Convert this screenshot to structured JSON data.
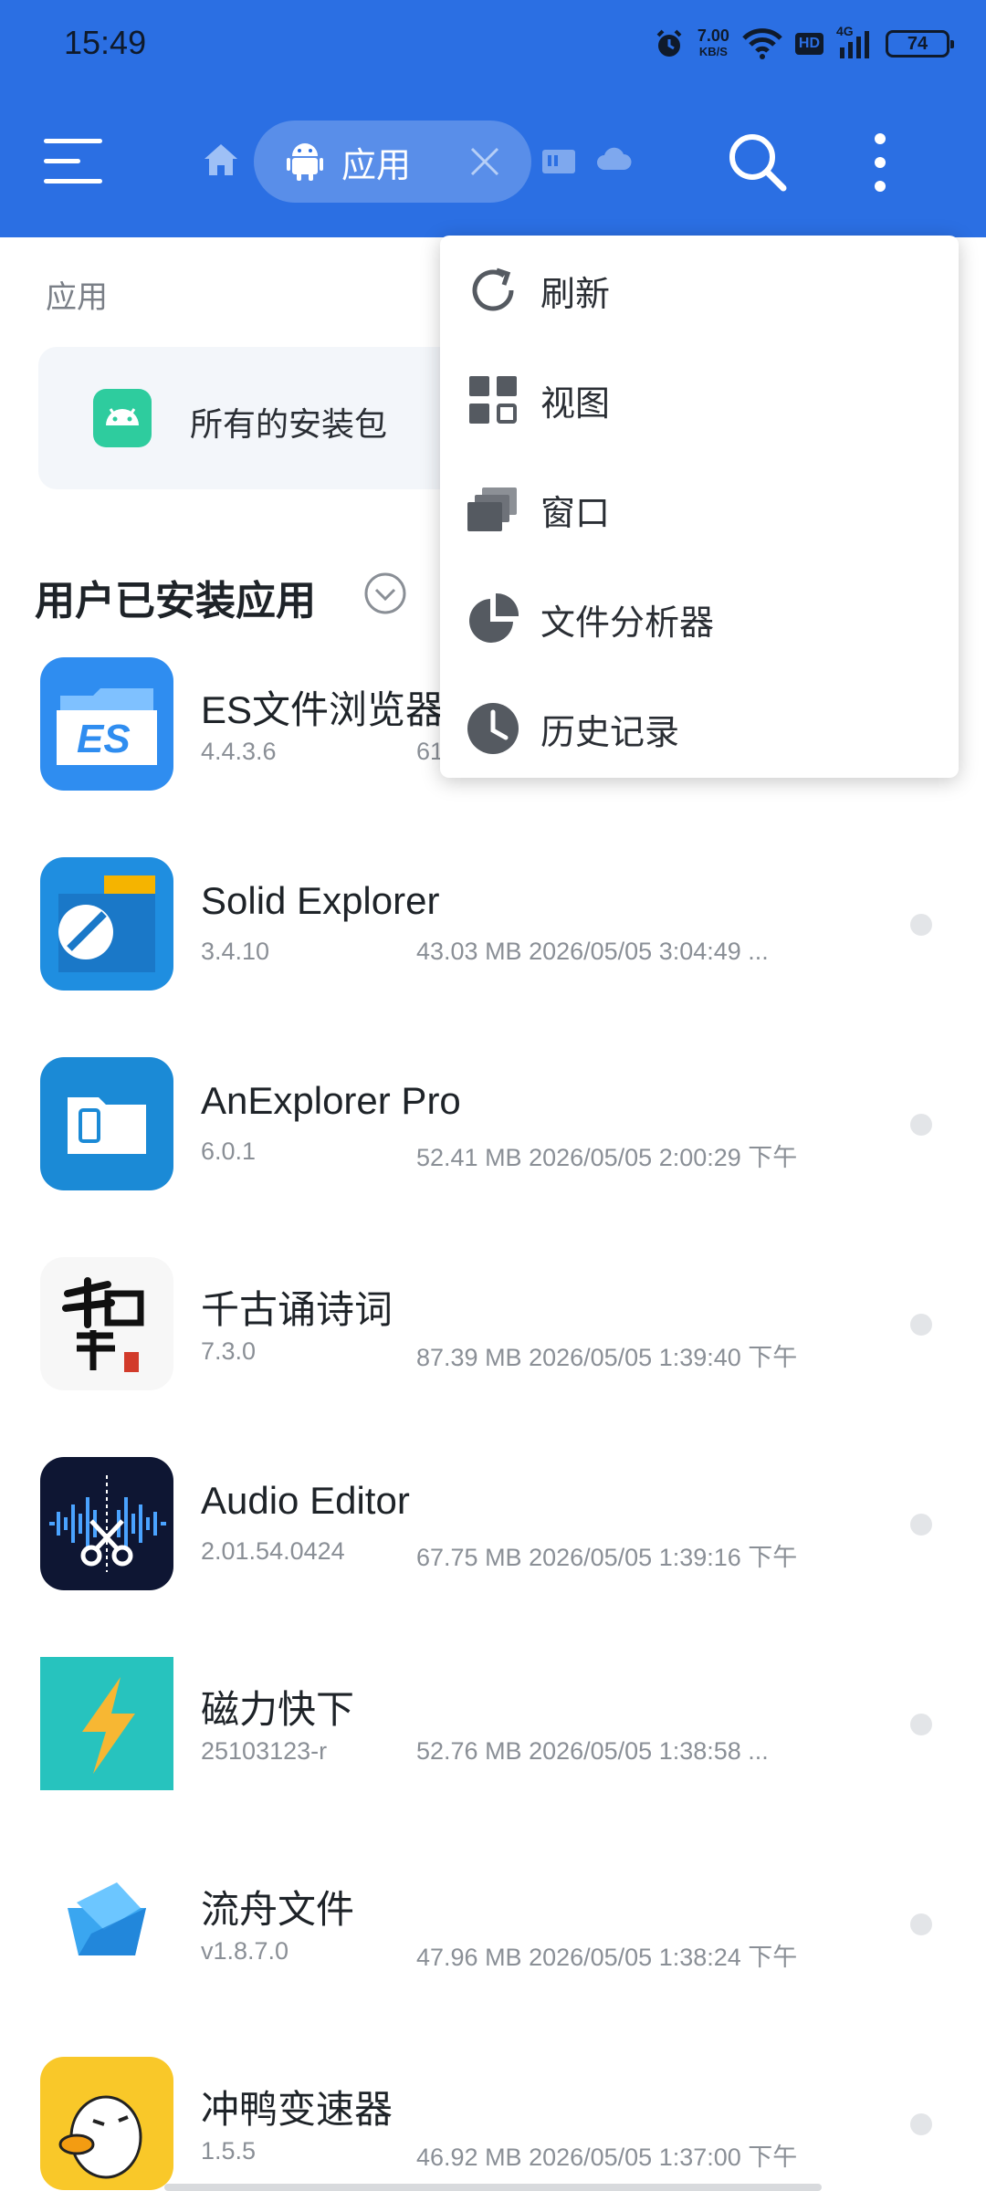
{
  "status_bar": {
    "time": "15:49",
    "net_speed_value": "7.00",
    "net_speed_unit": "KB/S",
    "hd": "HD",
    "network": "4G",
    "battery": "74"
  },
  "app_bar": {
    "tab_label": "应用"
  },
  "content": {
    "section_label": "应用",
    "package_card_label": "所有的安装包",
    "group_title": "用户已安装应用"
  },
  "apps": [
    {
      "name": "ES文件浏览器",
      "version": "4.4.3.6",
      "meta": "61"
    },
    {
      "name": "Solid Explorer",
      "version": "3.4.10",
      "meta": "43.03 MB 2026/05/05  3:04:49 ..."
    },
    {
      "name": "AnExplorer Pro",
      "version": "6.0.1",
      "meta": "52.41 MB 2026/05/05  2:00:29 下午"
    },
    {
      "name": "千古诵诗词",
      "version": "7.3.0",
      "meta": "87.39 MB 2026/05/05  1:39:40 下午"
    },
    {
      "name": "Audio Editor",
      "version": "2.01.54.0424",
      "meta": "67.75 MB 2026/05/05  1:39:16 下午"
    },
    {
      "name": "磁力快下",
      "version": "25103123-r",
      "meta": "52.76 MB 2026/05/05  1:38:58 ..."
    },
    {
      "name": "流舟文件",
      "version": "v1.8.7.0",
      "meta": "47.96 MB 2026/05/05  1:38:24 下午"
    },
    {
      "name": "冲鸭变速器",
      "version": "1.5.5",
      "meta": "46.92 MB 2026/05/05  1:37:00 下午"
    }
  ],
  "popup_menu": {
    "items": [
      {
        "label": "刷新",
        "icon": "refresh-icon"
      },
      {
        "label": "视图",
        "icon": "grid-view-icon"
      },
      {
        "label": "窗口",
        "icon": "windows-icon"
      },
      {
        "label": "文件分析器",
        "icon": "pie-chart-icon"
      },
      {
        "label": "历史记录",
        "icon": "clock-icon"
      }
    ]
  },
  "colors": {
    "primary": "#2b6fe3",
    "popup_icon": "#555a61"
  }
}
